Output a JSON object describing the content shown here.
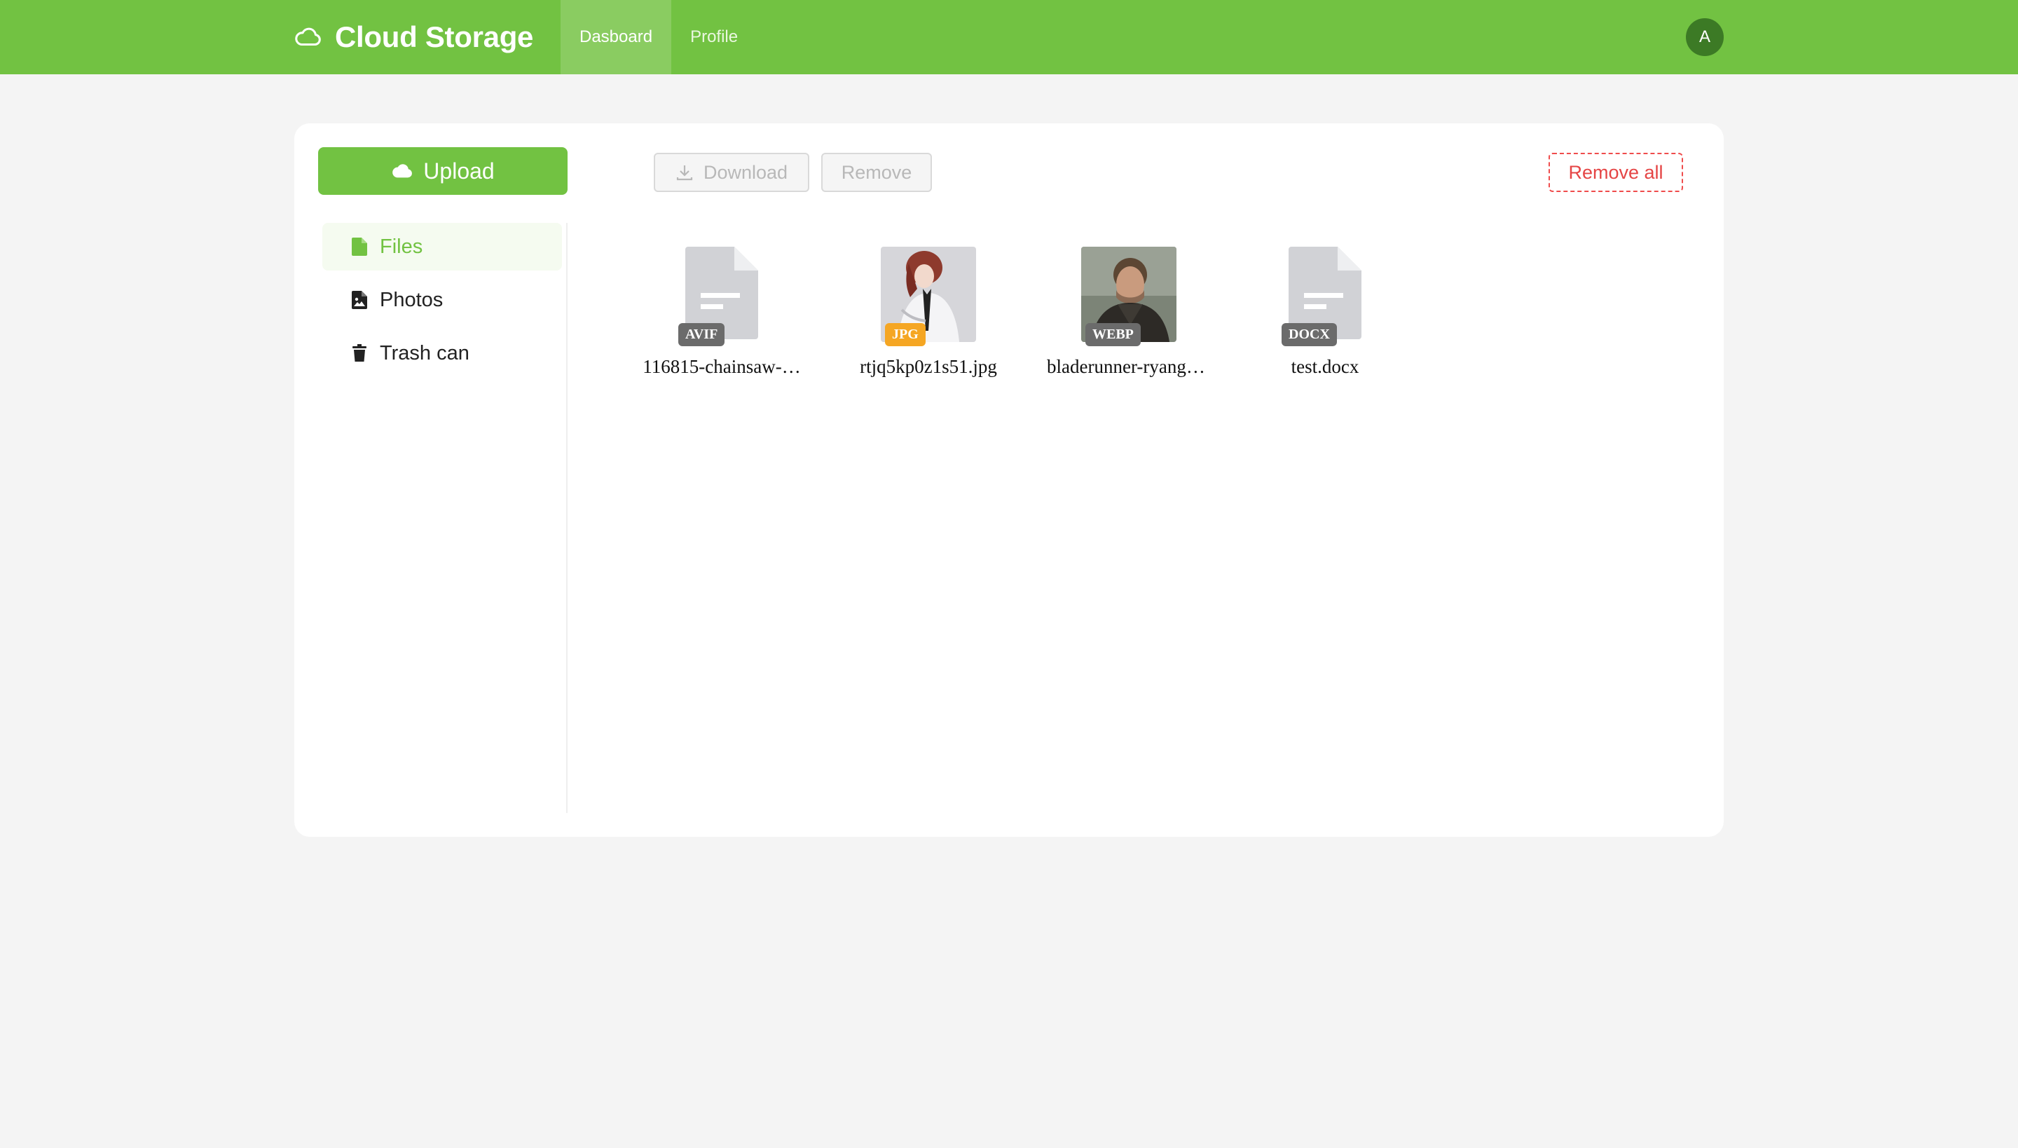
{
  "header": {
    "brand": "Cloud Storage",
    "nav": [
      {
        "label": "Dasboard"
      },
      {
        "label": "Profile"
      }
    ],
    "avatar_initial": "A"
  },
  "actions": {
    "upload": "Upload",
    "download": "Download",
    "remove": "Remove",
    "remove_all": "Remove all"
  },
  "sidebar": {
    "items": [
      {
        "label": "Files",
        "icon": "file-icon",
        "active": true
      },
      {
        "label": "Photos",
        "icon": "image-file-icon"
      },
      {
        "label": "Trash can",
        "icon": "trash-icon"
      }
    ]
  },
  "files": [
    {
      "name": "116815-chainsaw-…",
      "type": "AVIF",
      "badge_color": "#6b6b6b",
      "preview": "generic-document-icon"
    },
    {
      "name": "rtjq5kp0z1s51.jpg",
      "type": "JPG",
      "badge_color": "#f5a623",
      "preview": "photo-thumbnail"
    },
    {
      "name": "bladerunner-ryango…",
      "type": "WEBP",
      "badge_color": "#6b6b6b",
      "preview": "photo-thumbnail"
    },
    {
      "name": "test.docx",
      "type": "DOCX",
      "badge_color": "#6b6b6b",
      "preview": "generic-document-icon"
    }
  ],
  "colors": {
    "brand_green": "#72c242",
    "danger_red": "#e54545",
    "background": "#f4f4f4"
  }
}
